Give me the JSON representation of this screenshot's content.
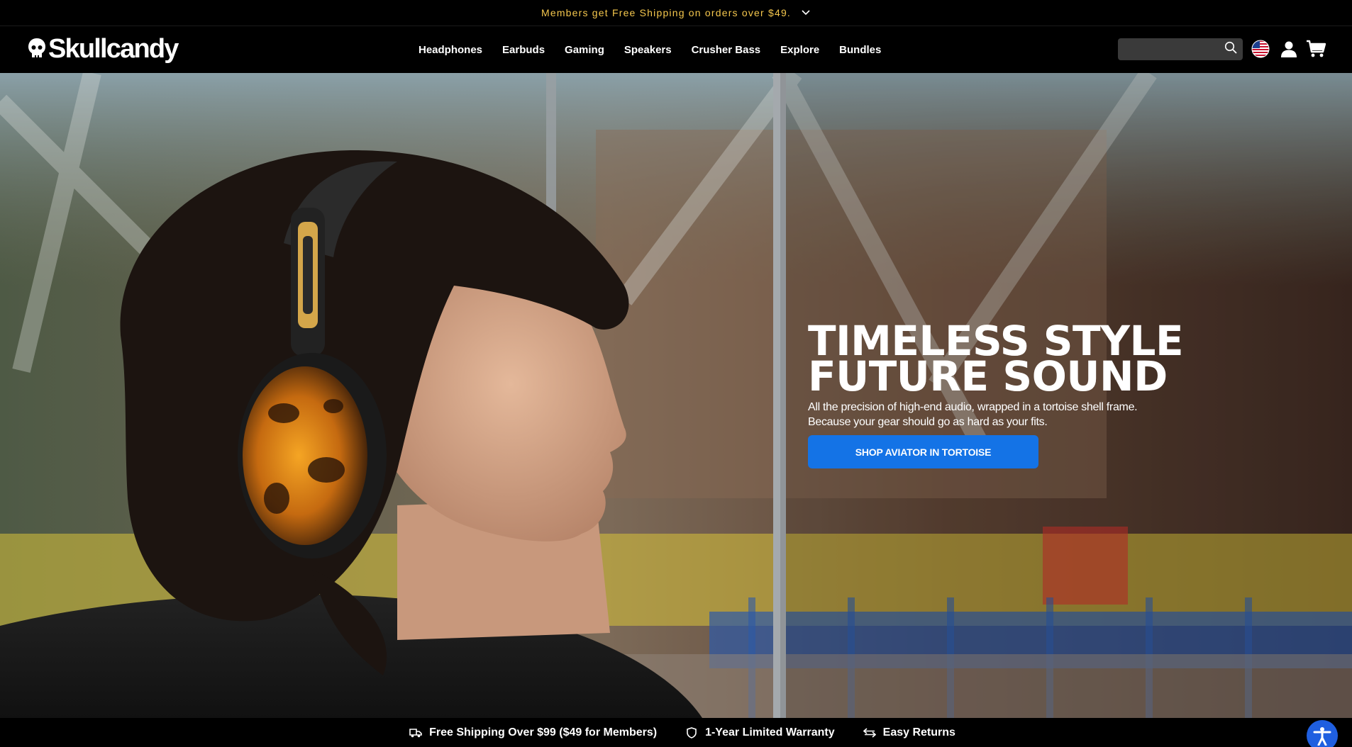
{
  "announcement": {
    "text": "Members get Free Shipping on orders over $49.",
    "chevron_icon": "chevron-down-icon",
    "color": "#f5c74d"
  },
  "header": {
    "logo_text": "Skullcandy",
    "nav": [
      "Headphones",
      "Earbuds",
      "Gaming",
      "Speakers",
      "Crusher Bass",
      "Explore",
      "Bundles"
    ],
    "search": {
      "placeholder": "",
      "icon": "search-icon"
    },
    "region_icon": "us-flag-icon",
    "account_icon": "user-icon",
    "cart_icon": "cart-icon"
  },
  "hero": {
    "title_line1": "TIMELESS STYLE",
    "title_line2": "FUTURE SOUND",
    "subtitle_line1": "All the precision of high-end audio, wrapped in a tortoise shell frame.",
    "subtitle_line2": "Because your gear should go as hard as your fits.",
    "cta_label": "SHOP AVIATOR IN TORTOISE",
    "cta_color": "#1473e6"
  },
  "benefits": [
    {
      "icon": "truck-icon",
      "label": "Free Shipping Over $99 ($49 for Members)"
    },
    {
      "icon": "shield-icon",
      "label": "1-Year Limited Warranty"
    },
    {
      "icon": "returns-arrows-icon",
      "label": "Easy Returns"
    }
  ],
  "accessibility": {
    "icon": "accessibility-icon",
    "color": "#1f5fe0"
  }
}
